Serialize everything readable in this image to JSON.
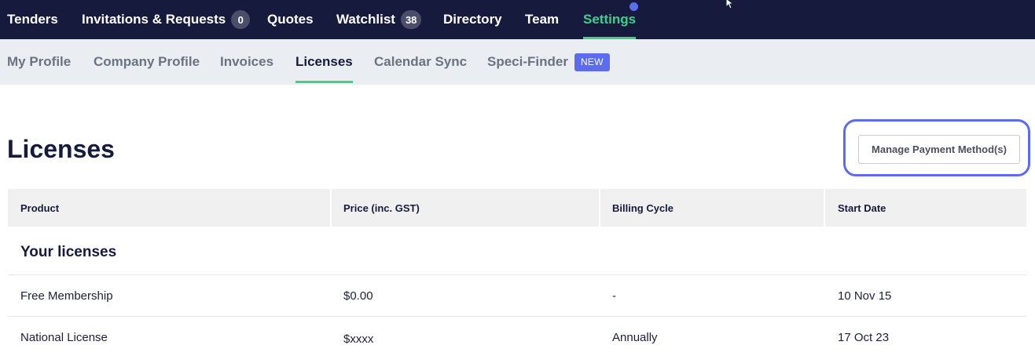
{
  "top_nav": {
    "items": [
      {
        "label": "Tenders"
      },
      {
        "label": "Invitations & Requests",
        "count": "0"
      },
      {
        "label": "Quotes"
      },
      {
        "label": "Watchlist",
        "count": "38"
      },
      {
        "label": "Directory"
      },
      {
        "label": "Team"
      },
      {
        "label": "Settings",
        "active": true
      }
    ],
    "active_color": "#3ecf8e",
    "background": "#161b3d"
  },
  "sub_nav": {
    "tabs": [
      {
        "label": "My Profile"
      },
      {
        "label": "Company Profile"
      },
      {
        "label": "Invoices"
      },
      {
        "label": "Licenses",
        "active": true
      },
      {
        "label": "Calendar Sync"
      },
      {
        "label": "Speci-Finder",
        "badge": "NEW"
      }
    ]
  },
  "page": {
    "title": "Licenses",
    "manage_button": "Manage Payment Method(s)"
  },
  "table": {
    "columns": [
      "Product",
      "Price (inc. GST)",
      "Billing Cycle",
      "Start Date"
    ],
    "section_title": "Your licenses",
    "rows": [
      [
        "Free Membership",
        "$0.00",
        "-",
        "10 Nov 15"
      ],
      [
        "National License",
        "$xxxx",
        "Annually",
        "17 Oct 23"
      ]
    ]
  }
}
